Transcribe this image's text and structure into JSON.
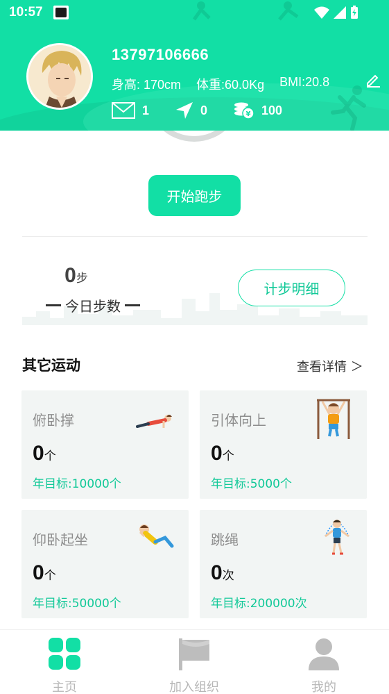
{
  "status_bar": {
    "time": "10:57"
  },
  "profile": {
    "phone": "13797106666",
    "height": "身高: 170cm",
    "weight": "体重:60.0Kg",
    "bmi": "BMI:20.8",
    "messages": "1",
    "location_count": "0",
    "coins": "100"
  },
  "start_button": "开始跑步",
  "steps": {
    "value": "0",
    "unit": "步",
    "label": "今日步数",
    "detail_button": "计步明细"
  },
  "other_sports": {
    "title": "其它运动",
    "more": "查看详情 ＞",
    "cards": [
      {
        "name": "俯卧撑",
        "count": "0",
        "unit": "个",
        "goal": "年目标:10000个",
        "icon": "pushup-icon"
      },
      {
        "name": "引体向上",
        "count": "0",
        "unit": "个",
        "goal": "年目标:5000个",
        "icon": "pullup-icon"
      },
      {
        "name": "仰卧起坐",
        "count": "0",
        "unit": "个",
        "goal": "年目标:50000个",
        "icon": "situp-icon"
      },
      {
        "name": "跳绳",
        "count": "0",
        "unit": "次",
        "goal": "年目标:200000次",
        "icon": "jump-rope-icon"
      }
    ]
  },
  "nav": {
    "items": [
      {
        "label": "主页",
        "icon": "home-grid-icon",
        "active": true
      },
      {
        "label": "加入组织",
        "icon": "flag-icon",
        "active": false
      },
      {
        "label": "我的",
        "icon": "user-icon",
        "active": false
      }
    ]
  },
  "colors": {
    "accent": "#12dfa5",
    "accent_text": "#12c998",
    "card_bg": "#f2f5f4"
  }
}
